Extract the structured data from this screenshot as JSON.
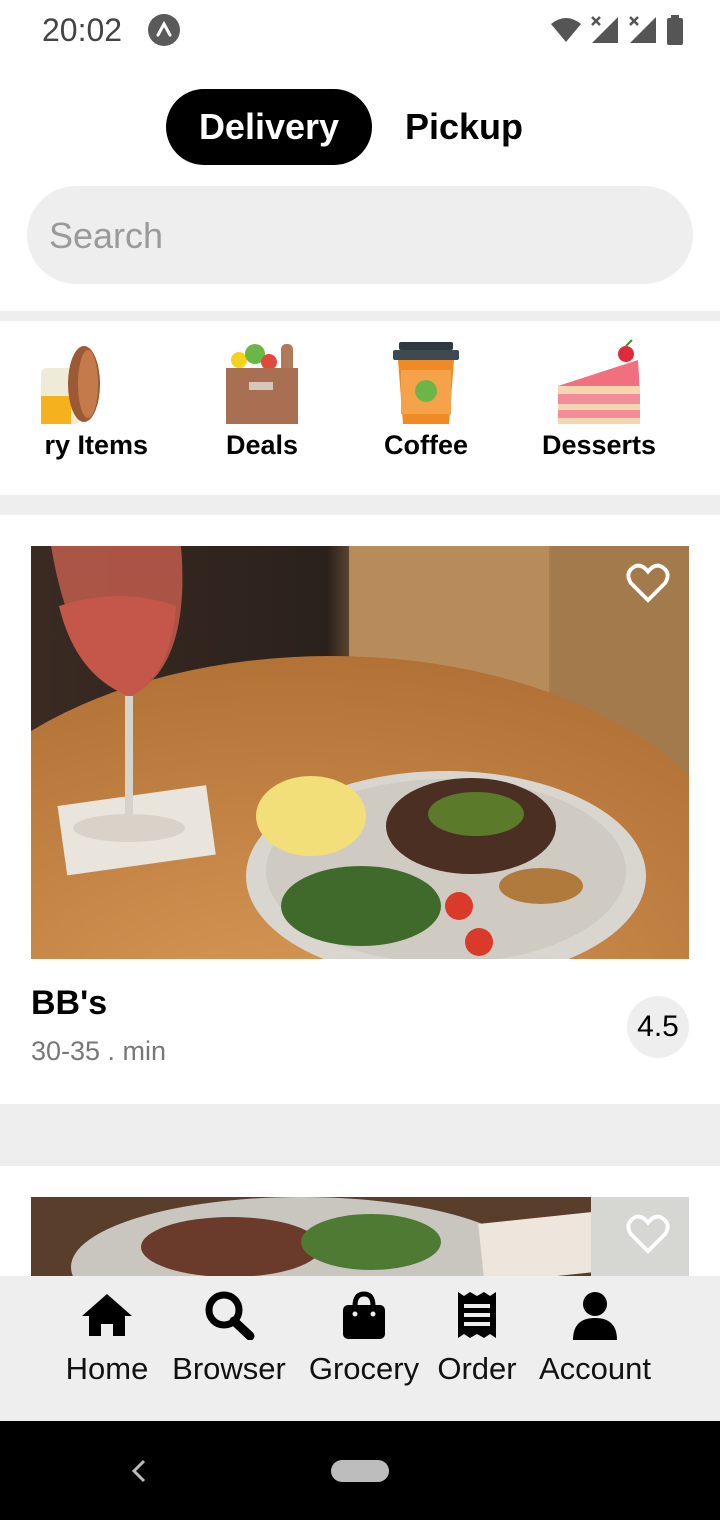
{
  "status_bar": {
    "time": "20:02"
  },
  "toggle": {
    "delivery": "Delivery",
    "pickup": "Pickup"
  },
  "search": {
    "placeholder": "Search"
  },
  "categories": [
    {
      "label": "ry Items",
      "icon": "bakery-icon"
    },
    {
      "label": "Deals",
      "icon": "grocery-bag-icon"
    },
    {
      "label": "Coffee",
      "icon": "coffee-cup-icon"
    },
    {
      "label": "Desserts",
      "icon": "cake-icon"
    }
  ],
  "restaurants": [
    {
      "name": "BB's",
      "time": "30-35 . min",
      "rating": "4.5"
    }
  ],
  "nav": [
    {
      "label": "Home",
      "icon": "home-icon"
    },
    {
      "label": "Browser",
      "icon": "search-icon"
    },
    {
      "label": "Grocery",
      "icon": "shopping-bag-icon"
    },
    {
      "label": "Order",
      "icon": "receipt-icon"
    },
    {
      "label": "Account",
      "icon": "user-icon"
    }
  ],
  "colors": {
    "accent": "#000000",
    "surface": "#eeeeee",
    "muted_text": "#777777"
  }
}
